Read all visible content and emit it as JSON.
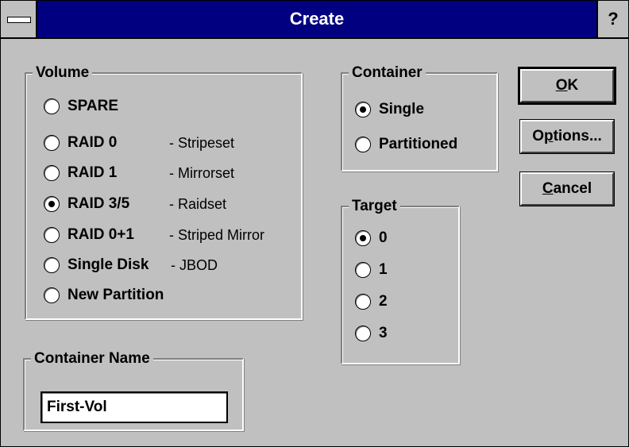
{
  "window": {
    "title": "Create",
    "help_glyph": "?"
  },
  "volume": {
    "label": "Volume",
    "options": [
      {
        "label": "SPARE",
        "desc": "",
        "checked": false
      },
      {
        "label": "RAID 0",
        "desc": "- Stripeset",
        "checked": false
      },
      {
        "label": "RAID 1",
        "desc": "- Mirrorset",
        "checked": false
      },
      {
        "label": "RAID 3/5",
        "desc": "- Raidset",
        "checked": true
      },
      {
        "label": "RAID 0+1",
        "desc": "- Striped Mirror",
        "checked": false
      },
      {
        "label": "Single Disk",
        "desc": "- JBOD",
        "checked": false
      },
      {
        "label": "New Partition",
        "desc": "",
        "checked": false
      }
    ]
  },
  "container": {
    "label": "Container",
    "options": [
      {
        "label": "Single",
        "checked": true
      },
      {
        "label": "Partitioned",
        "checked": false
      }
    ]
  },
  "target": {
    "label": "Target",
    "options": [
      {
        "label": "0",
        "checked": true
      },
      {
        "label": "1",
        "checked": false
      },
      {
        "label": "2",
        "checked": false
      },
      {
        "label": "3",
        "checked": false
      }
    ]
  },
  "container_name": {
    "label": "Container Name",
    "value": "First-Vol"
  },
  "buttons": {
    "ok": {
      "mnemonic": "O",
      "rest": "K"
    },
    "options": {
      "pre": "O",
      "mnemonic": "p",
      "rest": "tions..."
    },
    "cancel": {
      "mnemonic": "C",
      "rest": "ancel"
    }
  }
}
